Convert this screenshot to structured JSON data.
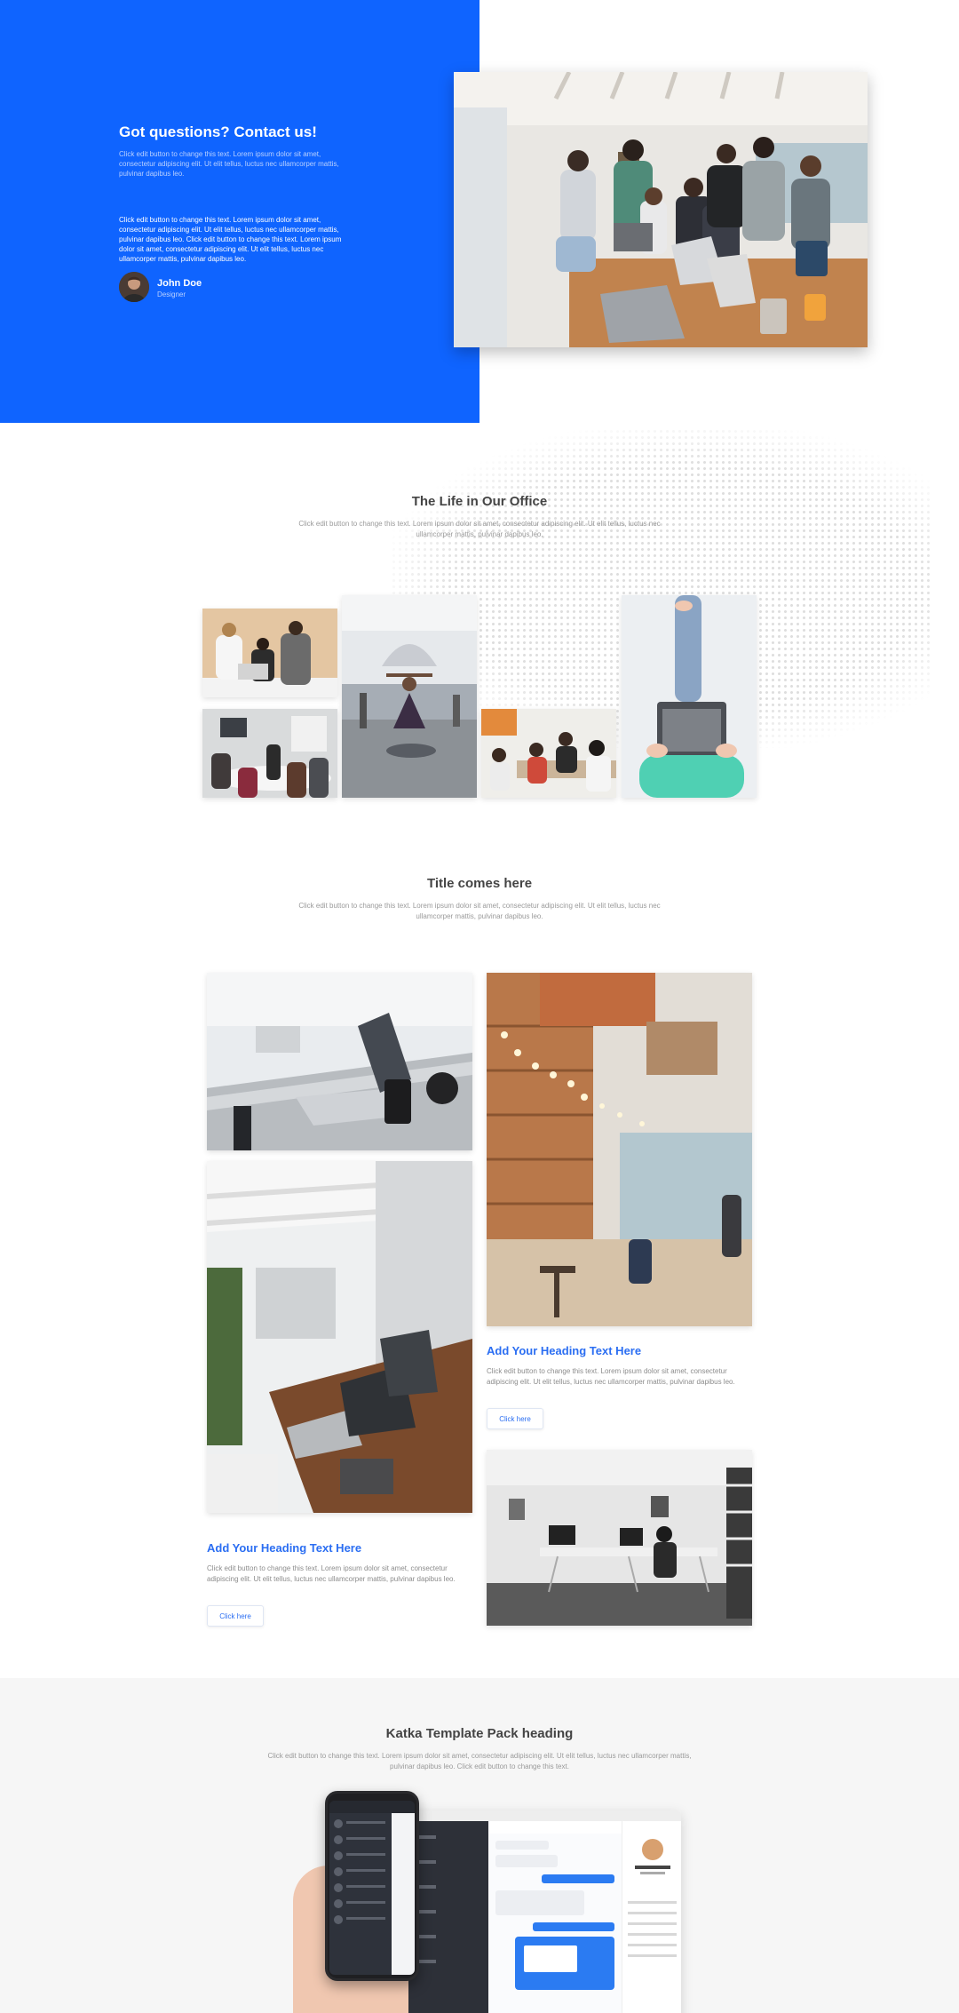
{
  "hero": {
    "title": "Got questions? Contact us!",
    "subtitle": "Click edit button to change this text. Lorem ipsum dolor sit amet, consectetur adipiscing elit. Ut elit tellus, luctus nec ullamcorper mattis, pulvinar dapibus leo.",
    "body": "Click edit button to change this text. Lorem ipsum dolor sit amet, consectetur adipiscing elit. Ut elit tellus, luctus nec ullamcorper mattis, pulvinar dapibus leo. Click edit button to change this text. Lorem ipsum dolor sit amet, consectetur adipiscing elit. Ut elit tellus, luctus nec ullamcorper mattis, pulvinar dapibus leo.",
    "author_name": "John Doe",
    "author_role": "Designer"
  },
  "office": {
    "title": "The Life in Our Office",
    "subtitle": "Click edit button to change this text. Lorem ipsum dolor sit amet, consectetur adipiscing elit. Ut elit tellus, luctus nec ullamcorper mattis, pulvinar dapibus leo."
  },
  "features": {
    "title": "Title comes here",
    "subtitle": "Click edit button to change this text. Lorem ipsum dolor sit amet, consectetur adipiscing elit. Ut elit tellus, luctus nec ullamcorper mattis, pulvinar dapibus leo.",
    "card_right": {
      "heading": "Add Your Heading Text Here",
      "text": "Click edit button to change this text. Lorem ipsum dolor sit amet, consectetur adipiscing elit. Ut elit tellus, luctus nec ullamcorper mattis, pulvinar dapibus leo.",
      "button": "Click here"
    },
    "card_left": {
      "heading": "Add Your Heading Text Here",
      "text": "Click edit button to change this text. Lorem ipsum dolor sit amet, consectetur adipiscing elit. Ut elit tellus, luctus nec ullamcorper mattis, pulvinar dapibus leo.",
      "button": "Click here"
    }
  },
  "bottom": {
    "title": "Katka Template Pack heading",
    "subtitle": "Click edit button to change this text. Lorem ipsum dolor sit amet, consectetur adipiscing elit. Ut elit tellus, luctus nec ullamcorper mattis, pulvinar dapibus leo. Click edit button to change this text."
  },
  "colors": {
    "brand_blue": "#0f64ff",
    "accent_link": "#2b6ef2"
  }
}
